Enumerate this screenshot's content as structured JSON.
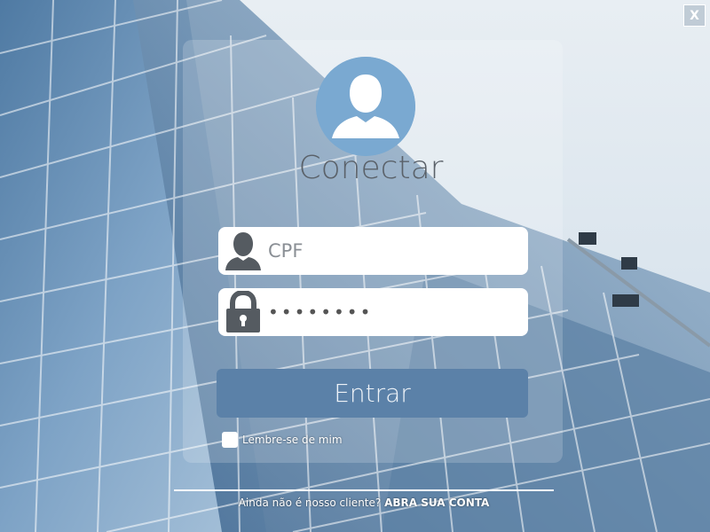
{
  "window": {
    "close_label": "X"
  },
  "login": {
    "title": "Conectar",
    "cpf_placeholder": "CPF",
    "password_value": "••••••••",
    "submit_label": "Entrar",
    "remember_label": "Lembre-se de mim"
  },
  "footer": {
    "question": "Ainda não é nosso cliente? ",
    "link_label": "ABRA SUA CONTA"
  },
  "colors": {
    "accent": "#5b81a8",
    "avatar_bg": "#7aa9d1",
    "icon_gray": "#555b61"
  },
  "icons": {
    "close": "close-icon",
    "avatar": "user-avatar-icon",
    "cpf": "user-icon",
    "password": "lock-icon"
  }
}
